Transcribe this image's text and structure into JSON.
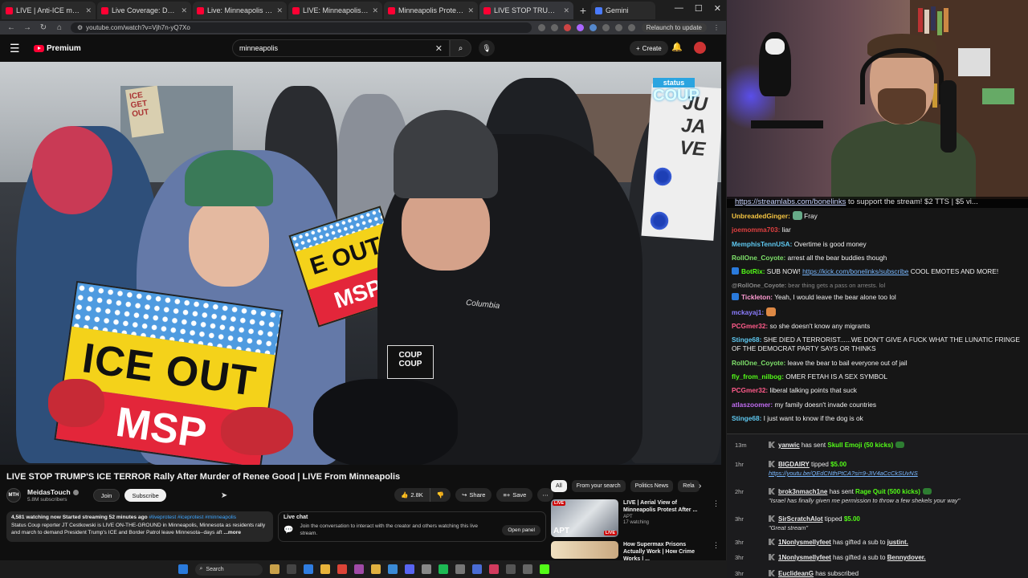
{
  "browser": {
    "tabs": [
      {
        "label": "LIVE | Anti-ICE march set to take..."
      },
      {
        "label": "Live Coverage: Demonstrators..."
      },
      {
        "label": "Live: Minneapolis ICE shooting..."
      },
      {
        "label": "LIVE: Minneapolis shooting ICE..."
      },
      {
        "label": "Minneapolis Protest - LIVE on..."
      },
      {
        "label": "LIVE STOP TRUMP'S ICE TERROR..."
      },
      {
        "label": "Gemini"
      }
    ],
    "url": "youtube.com/watch?v=Vjh7n-yQ7Xo",
    "relaunch_label": "Relaunch to update"
  },
  "youtube": {
    "brand": "Premium",
    "search_value": "minneapolis",
    "create_label": "Create",
    "video": {
      "title": "LIVE STOP TRUMP'S ICE TERROR Rally After Murder of Renee Good | LIVE From Minneapolis",
      "sign_main_line1": "ICE OUT",
      "sign_main_line2": "MSP",
      "sign_mid_line1": "E OUT",
      "sign_mid_line2": "MSP",
      "sign_handwritten": "ICE GET OUT",
      "sign_right": "JU JA VE",
      "overlay_line1": "status",
      "overlay_line2": "COUP",
      "mic_flag": "COUP COUP",
      "jacket_brand": "Columbia"
    },
    "channel": {
      "logo_text": "MTH",
      "name": "MeidasTouch",
      "subscribers": "5.8M subscribers",
      "join_label": "Join",
      "subscribe_label": "Subscribe"
    },
    "actions": {
      "likes": "2.8K",
      "share_label": "Share",
      "save_label": "Save"
    },
    "description": {
      "stats": "4,581 watching now  Started streaming 52 minutes ago",
      "tags": "#liveprotest #iceprotest #minneapolis",
      "text": "Status Coup reporter JT Cestkowski is LIVE ON-THE-GROUND in Minneapolis, Minnesota as residents rally and march to demand President Trump's ICE and Border Patrol leave Minnesota--days aft",
      "more": "...more"
    },
    "live_chat": {
      "title": "Live chat",
      "text": "Join the conversation to interact with the creator and others watching this live stream.",
      "open_panel": "Open panel"
    },
    "chips": [
      "All",
      "From your search",
      "Politics News",
      "Rela"
    ],
    "recommendations": [
      {
        "title": "LIVE | Aerial View of Minneapolis Protest After ...",
        "channel": "APT",
        "meta": "17 watching",
        "badge": "LIVE",
        "badge2": "LIVE",
        "thumb_text": "APT"
      },
      {
        "title": "How Supermax Prisons Actually Work | How Crime Works | ...",
        "channel": "",
        "meta": "",
        "badge": "",
        "badge2": "",
        "thumb_text": ""
      }
    ]
  },
  "taskbar": {
    "search_label": "Search"
  },
  "stream": {
    "banner_link": "https://streamlabs.com/bonelinks",
    "banner_text": " to support the stream! $2 TTS | $5 vi..."
  },
  "chat": [
    {
      "user": "UnbreadedGinger:",
      "color": "#f5c542",
      "text": " Fray",
      "emote": "#6a8"
    },
    {
      "user": "joemomma703:",
      "color": "#e04040",
      "text": " liar"
    },
    {
      "user": "MemphisTennUSA:",
      "color": "#5ec8f0",
      "text": " Overtime is good money"
    },
    {
      "user": "RollOne_Coyote:",
      "color": "#7ee06a",
      "text": " arrest all the bear buddies though"
    },
    {
      "user": "BotRix:",
      "color": "#53fc18",
      "text": " SUB NOW! ",
      "link": "https://kick.com/bonelinks/subscribe",
      "text2": " COOL EMOTES AND MORE!",
      "badge": "#2a7adb"
    },
    {
      "user": "@RollOne_Coyote:",
      "color": "#888",
      "text": " bear thing gets a pass on arrests. lol",
      "reply": true
    },
    {
      "user": "Tickleton:",
      "color": "#ff9bd2",
      "text": " Yeah, I would leave the bear alone too lol",
      "badge": "#2a7adb"
    },
    {
      "user": "mckayaj1:",
      "color": "#8c7dff",
      "text": " ",
      "emote": "#d84"
    },
    {
      "user": "PCGmer32:",
      "color": "#ff5b8a",
      "text": " so she doesn't know any migrants"
    },
    {
      "user": "Stinge68:",
      "color": "#5ec8f0",
      "text": " SHE DIED A TERRORIST......WE DON'T GIVE A FUCK WHAT THE LUNATIC FRINGE OF THE DEMOCRAT PARTY SAYS OR THINKS"
    },
    {
      "user": "RollOne_Coyote:",
      "color": "#7ee06a",
      "text": " leave the bear to bail everyone out of jail"
    },
    {
      "user": "fly_from_nilbog:",
      "color": "#53fc18",
      "text": " OMER FETAH IS A SEX SYMBOL"
    },
    {
      "user": "PCGmer32:",
      "color": "#ff5b8a",
      "text": " liberal talking points that suck"
    },
    {
      "user": "atlaszoomer:",
      "color": "#c06cf0",
      "text": " my family doesn't invade countries"
    },
    {
      "user": "Stinge68:",
      "color": "#5ec8f0",
      "text": " I just want to know if the dog is ok"
    }
  ],
  "events": [
    {
      "time": "13m",
      "who": "yanwic",
      "action": " has sent ",
      "gift": "Skull Emoji (50 kicks)",
      "amount": "",
      "msg": "",
      "linkmsg": "",
      "kbadge": true
    },
    {
      "time": "1hr",
      "who": "BIGDAIRY",
      "action": " tipped ",
      "gift": "",
      "amount": "$5.00",
      "msg": "",
      "linkmsg": "https://youtu.be/QEdCNthPtCA?si=9-JIV4aCcCkSUvNS",
      "kbadge": false
    },
    {
      "time": "2hr",
      "who": "brok3nmach1ne",
      "action": " has sent ",
      "gift": "Rage Quit (500 kicks)",
      "amount": "",
      "msg": "\"Israel has finally given me permission to throw a few shekels your way\"",
      "linkmsg": "",
      "kbadge": true
    },
    {
      "time": "3hr",
      "who": "SirScratchAlot",
      "action": " tipped ",
      "gift": "",
      "amount": "$5.00",
      "msg": "\"Great stream\"",
      "linkmsg": "",
      "kbadge": false
    },
    {
      "time": "3hr",
      "who": "1Nonlysmellyfeet",
      "action": " has gifted a sub to ",
      "gift": "",
      "amount": "",
      "target": "justint.",
      "msg": "",
      "linkmsg": "",
      "kbadge": false
    },
    {
      "time": "3hr",
      "who": "1Nonlysmellyfeet",
      "action": " has gifted a sub to ",
      "gift": "",
      "amount": "",
      "target": "Bennydover.",
      "msg": "",
      "linkmsg": "",
      "kbadge": false
    },
    {
      "time": "3hr",
      "who": "EuclideanG",
      "action": " has subscribed",
      "gift": "",
      "amount": "",
      "msg": "",
      "linkmsg": "",
      "kbadge": false
    }
  ]
}
